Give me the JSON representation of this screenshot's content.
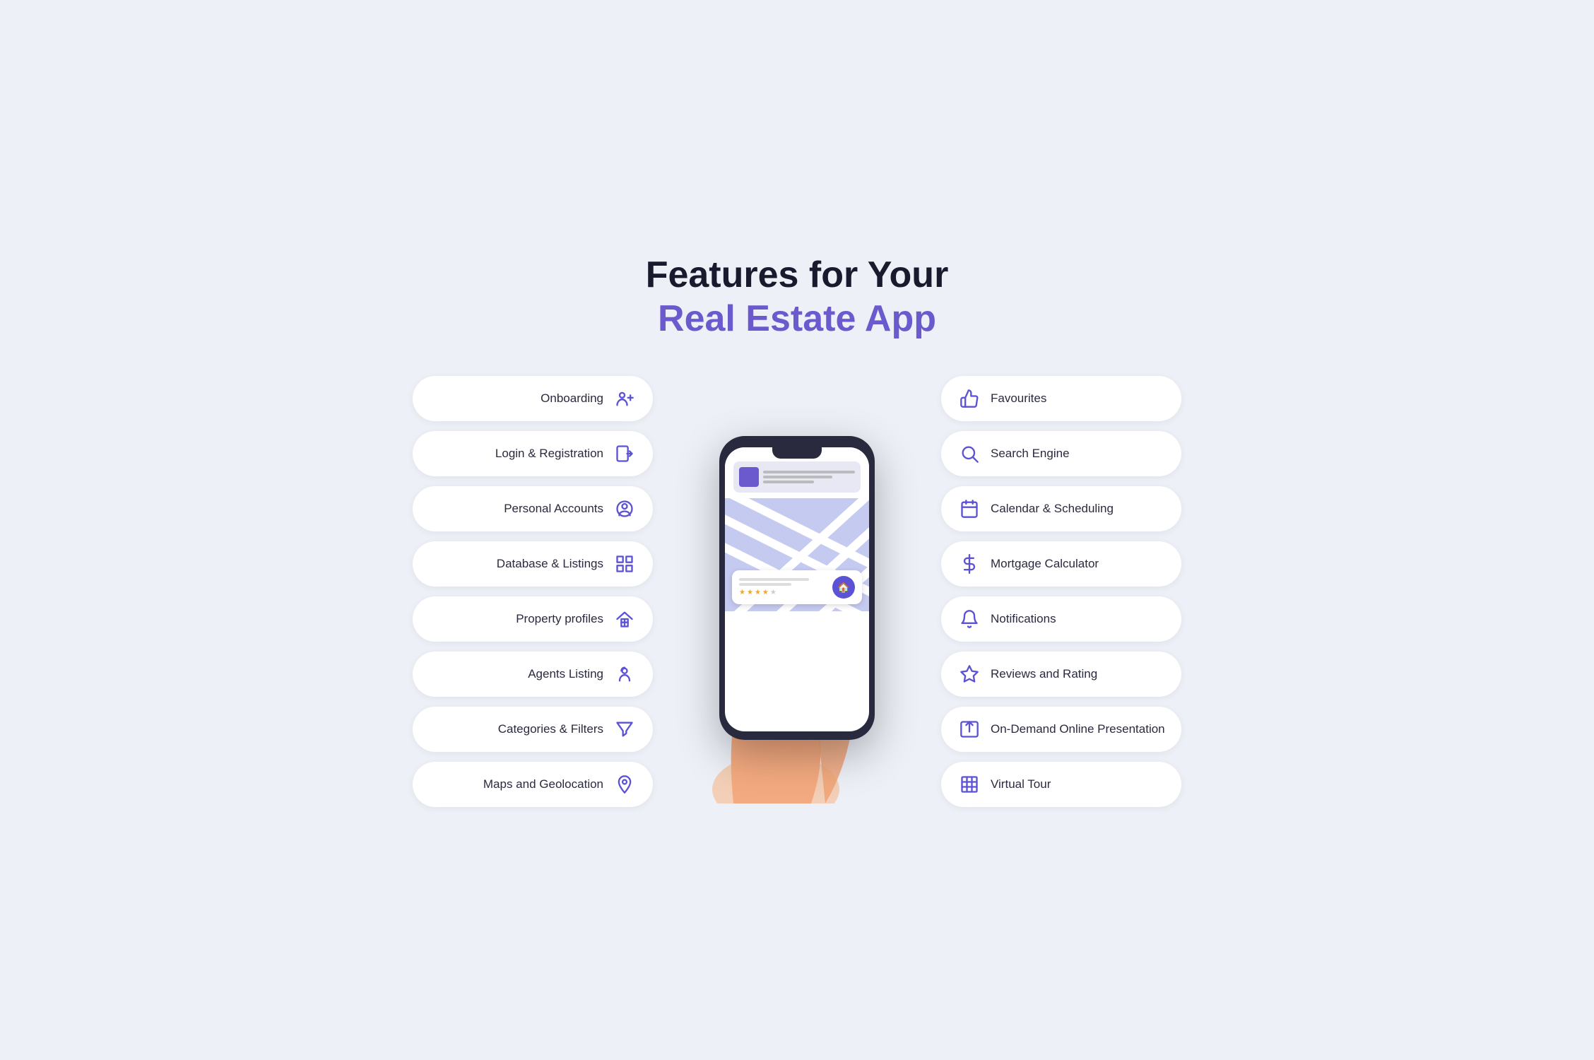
{
  "header": {
    "line1": "Features for Your",
    "line2": "Real Estate App"
  },
  "left_features": [
    {
      "id": "onboarding",
      "label": "Onboarding",
      "icon": "user-plus"
    },
    {
      "id": "login-registration",
      "label": "Login & Registration",
      "icon": "login"
    },
    {
      "id": "personal-accounts",
      "label": "Personal Accounts",
      "icon": "user-circle"
    },
    {
      "id": "database-listings",
      "label": "Database & Listings",
      "icon": "grid"
    },
    {
      "id": "property-profiles",
      "label": "Property profiles",
      "icon": "home-grid"
    },
    {
      "id": "agents-listing",
      "label": "Agents Listing",
      "icon": "agent"
    },
    {
      "id": "categories-filters",
      "label": "Categories & Filters",
      "icon": "filter"
    },
    {
      "id": "maps-geolocation",
      "label": "Maps and Geolocation",
      "icon": "map-pin"
    }
  ],
  "right_features": [
    {
      "id": "favourites",
      "label": "Favourites",
      "icon": "thumbs-up"
    },
    {
      "id": "search-engine",
      "label": "Search Engine",
      "icon": "search"
    },
    {
      "id": "calendar-scheduling",
      "label": "Calendar & Scheduling",
      "icon": "calendar"
    },
    {
      "id": "mortgage-calculator",
      "label": "Mortgage Calculator",
      "icon": "dollar"
    },
    {
      "id": "notifications",
      "label": "Notifications",
      "icon": "bell"
    },
    {
      "id": "reviews-rating",
      "label": "Reviews and Rating",
      "icon": "star"
    },
    {
      "id": "on-demand-presentation",
      "label": "On-Demand Online Presentation",
      "icon": "upload-box"
    },
    {
      "id": "virtual-tour",
      "label": "Virtual Tour",
      "icon": "building"
    }
  ],
  "phone": {
    "stars": [
      "filled",
      "filled",
      "filled",
      "filled",
      "half"
    ]
  }
}
